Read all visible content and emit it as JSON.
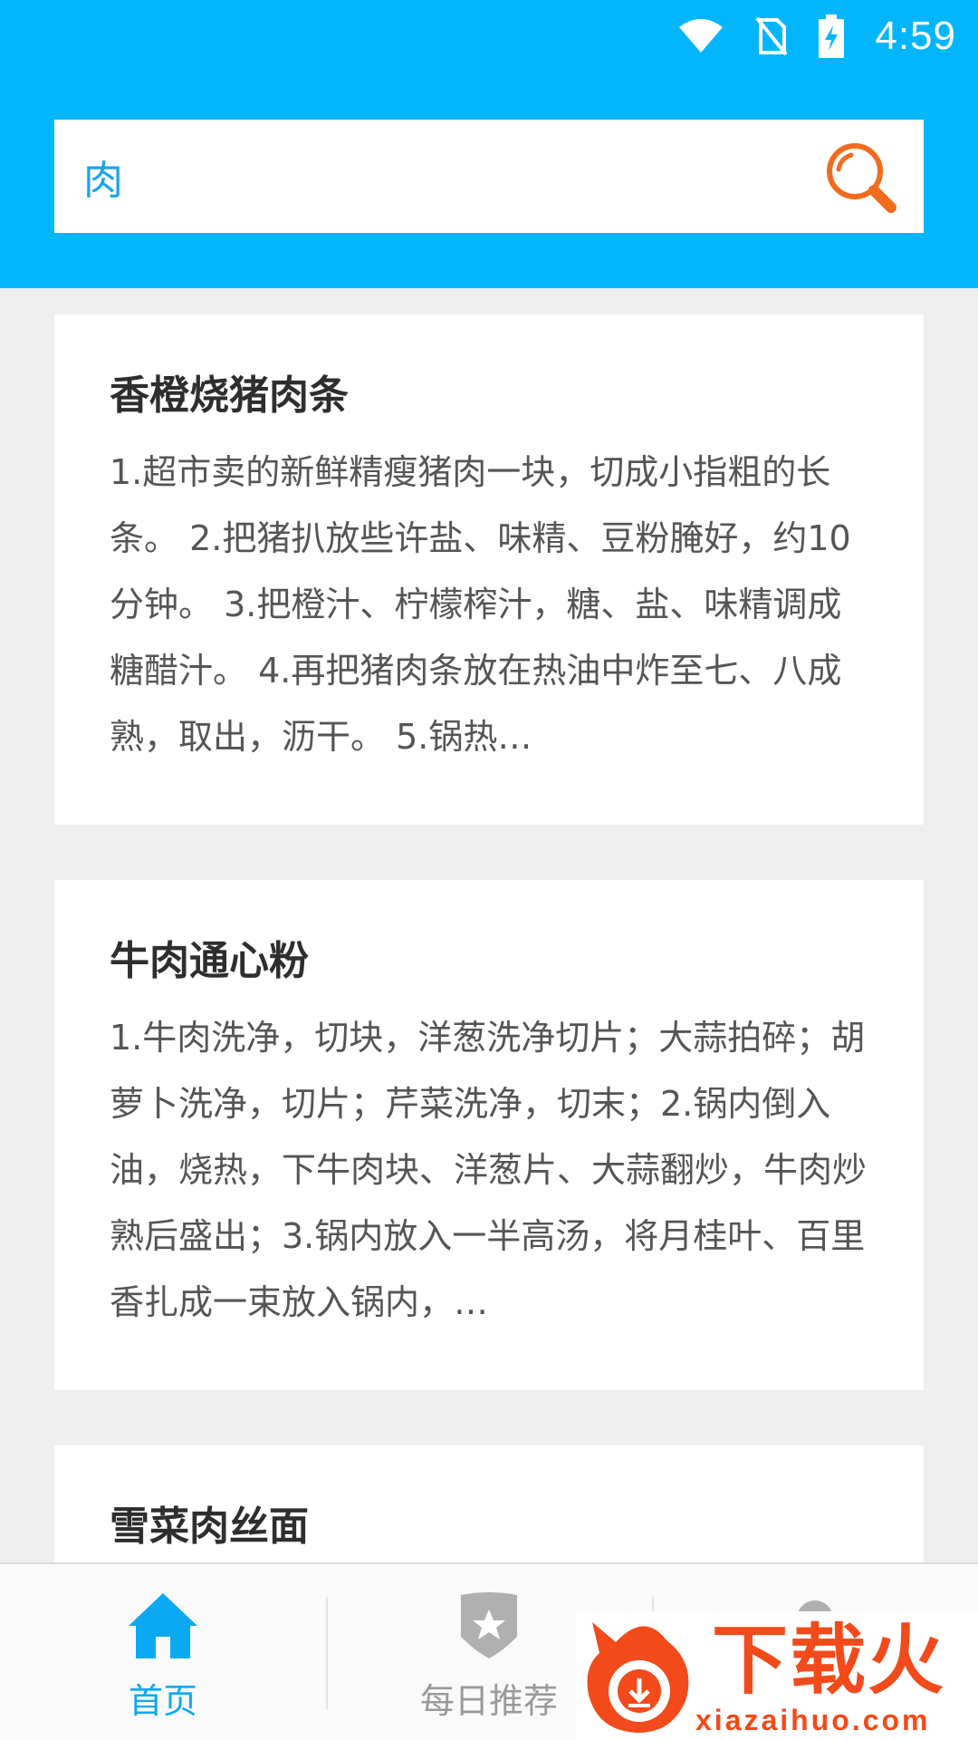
{
  "status_bar": {
    "time": "4:59",
    "icons": [
      "wifi-icon",
      "no-sim-icon",
      "battery-charging-icon"
    ]
  },
  "search": {
    "value": "肉",
    "icon": "search-icon",
    "icon_color": "#f26b1d"
  },
  "colors": {
    "header": "#03b6fb",
    "accent": "#0aa9f2",
    "background": "#efefef"
  },
  "results": [
    {
      "title": "香橙烧猪肉条",
      "description": "1.超市卖的新鲜精瘦猪肉一块，切成小指粗的长条。 2.把猪扒放些许盐、味精、豆粉腌好，约10分钟。 3.把橙汁、柠檬榨汁，糖、盐、味精调成糖醋汁。 4.再把猪肉条放在热油中炸至七、八成熟，取出，沥干。 5.锅热…"
    },
    {
      "title": "牛肉通心粉",
      "description": "1.牛肉洗净，切块，洋葱洗净切片；大蒜拍碎；胡萝卜洗净，切片；芹菜洗净，切末；2.锅内倒入油，烧热，下牛肉块、洋葱片、大蒜翻炒，牛肉炒熟后盛出；3.锅内放入一半高汤，将月桂叶、百里香扎成一束放入锅内，…"
    },
    {
      "title": "雪菜肉丝面",
      "description": ""
    }
  ],
  "bottom_nav": [
    {
      "label": "首页",
      "icon": "home-icon",
      "active": true
    },
    {
      "label": "每日推荐",
      "icon": "star-badge-icon",
      "active": false
    },
    {
      "label": "",
      "icon": "profile-icon",
      "active": false
    }
  ],
  "watermark": {
    "text": "下载火",
    "url": "xiazaihuo.com"
  }
}
